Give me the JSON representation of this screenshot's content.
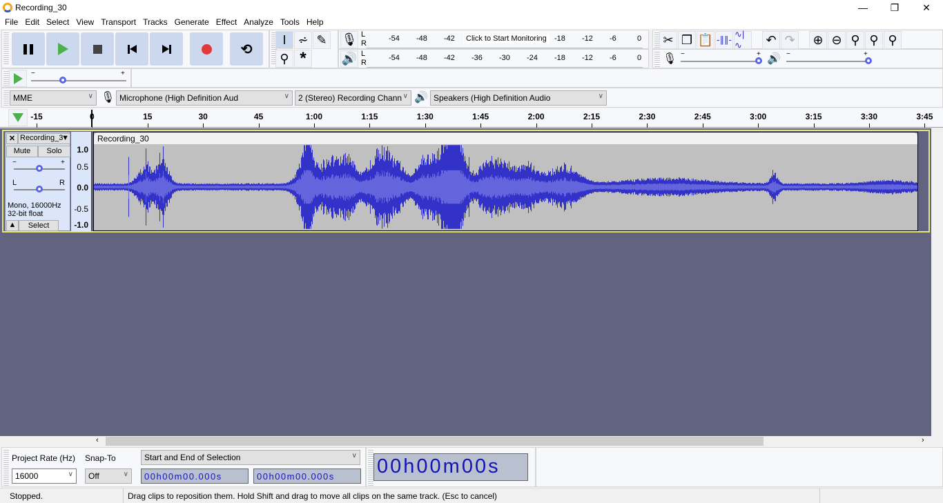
{
  "window": {
    "title": "Recording_30",
    "minimize": "—",
    "maximize": "❐",
    "close": "✕"
  },
  "menu": [
    "File",
    "Edit",
    "Select",
    "View",
    "Transport",
    "Tracks",
    "Generate",
    "Effect",
    "Analyze",
    "Tools",
    "Help"
  ],
  "transport": {
    "pause": "Pause",
    "play": "Play",
    "stop": "Stop",
    "skip_start": "Skip to Start",
    "skip_end": "Skip to End",
    "record": "Record",
    "loop": "Loop"
  },
  "meters": {
    "record_ticks": [
      "-54",
      "-48",
      "-42",
      "-18",
      "-12",
      "-6",
      "0"
    ],
    "monitor_label": "Click to Start Monitoring",
    "play_ticks": [
      "-54",
      "-48",
      "-42",
      "-36",
      "-30",
      "-24",
      "-18",
      "-12",
      "-6",
      "0"
    ],
    "L": "L",
    "R": "R"
  },
  "devices": {
    "host": "MME",
    "input": "Microphone (High Definition Aud",
    "channels": "2 (Stereo) Recording Chann",
    "output": "Speakers (High Definition Audio"
  },
  "ruler": [
    "-15",
    "0",
    "15",
    "30",
    "45",
    "1:00",
    "1:15",
    "1:30",
    "1:45",
    "2:00",
    "2:15",
    "2:30",
    "2:45",
    "3:00",
    "3:15",
    "3:30",
    "3:45"
  ],
  "track": {
    "name": "Recording_3",
    "clip_name": "Recording_30",
    "mute": "Mute",
    "solo": "Solo",
    "gain_minus": "−",
    "gain_plus": "+",
    "pan_l": "L",
    "pan_r": "R",
    "info1": "Mono, 16000Hz",
    "info2": "32-bit float",
    "select": "Select",
    "vruler": [
      "1.0",
      "0.5",
      "0.0",
      "-0.5",
      "-1.0"
    ],
    "wave_color": "#3232c8",
    "gain_level": 0.5,
    "pan_level": 0.5
  },
  "speed": {
    "minus": "−",
    "plus": "+",
    "level": 0.33
  },
  "mixer": {
    "minus": "−",
    "plus": "+",
    "record_level": 1.0,
    "play_level": 1.0
  },
  "bottom": {
    "rate_label": "Project Rate (Hz)",
    "rate": "16000",
    "snap_label": "Snap-To",
    "snap": "Off",
    "selection_mode": "Start and End of Selection",
    "sel_start": "00h00m00.000s",
    "sel_end": "00h00m00.000s",
    "time": {
      "h": "00",
      "hu": "h",
      "m": "00",
      "mu": "m",
      "s": "00",
      "su": "s"
    }
  },
  "status": {
    "state": "Stopped.",
    "hint": "Drag clips to reposition them. Hold Shift and drag to move all clips on the same track. (Esc to cancel)"
  }
}
